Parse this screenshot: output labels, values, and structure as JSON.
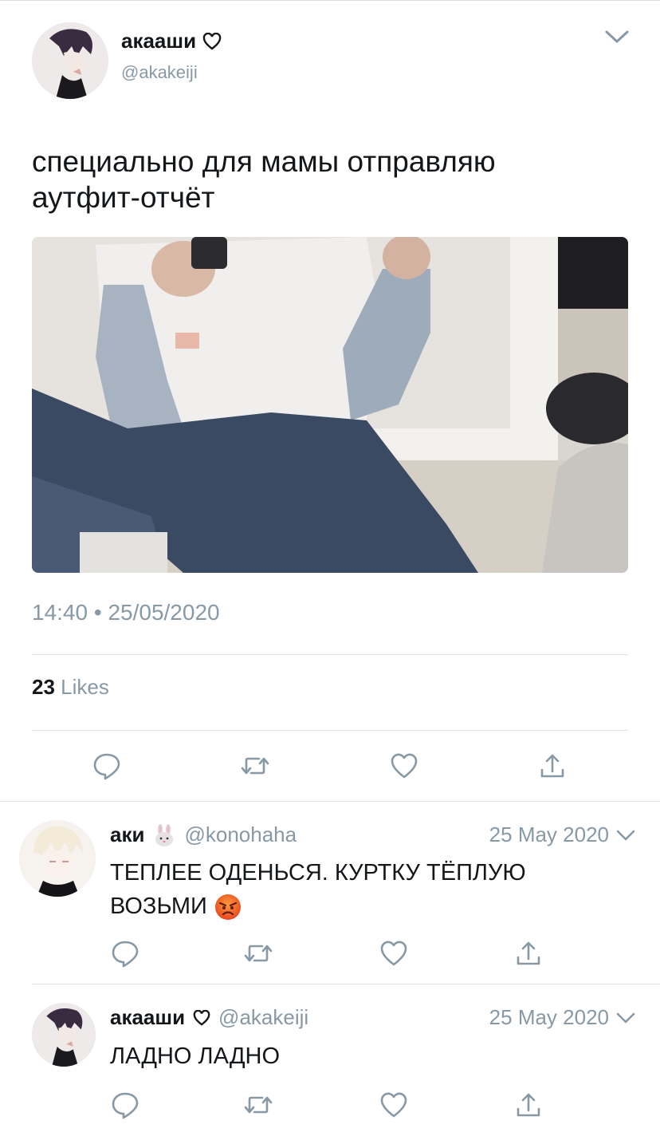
{
  "tweet": {
    "author_name": "акааши",
    "author_handle": "@akakeiji",
    "text_line1": "специально для мамы отправляю",
    "text_line2": "аутфит-отчёт",
    "time": "14:40",
    "separator": "•",
    "date": "25/05/2020",
    "likes_count": "23",
    "likes_label": "Likes"
  },
  "replies": [
    {
      "author_name": "аки",
      "author_handle": "@konohaha",
      "date": "25 May 2020",
      "text_line1": "ТЕПЛЕЕ ОДЕНЬСЯ. КУРТКУ ТЁПЛУЮ",
      "text_line2": "ВОЗЬМИ"
    },
    {
      "author_name": "акааши",
      "author_handle": "@akakeiji",
      "date": "25 May 2020",
      "text": "ЛАДНО ЛАДНО"
    }
  ],
  "icons": {
    "reply": "reply-icon",
    "retweet": "retweet-icon",
    "like": "heart-icon",
    "share": "share-icon",
    "more": "chevron-down-icon"
  },
  "colors": {
    "text": "#14171a",
    "secondary": "#8899a6",
    "divider": "#dfe3e6"
  }
}
